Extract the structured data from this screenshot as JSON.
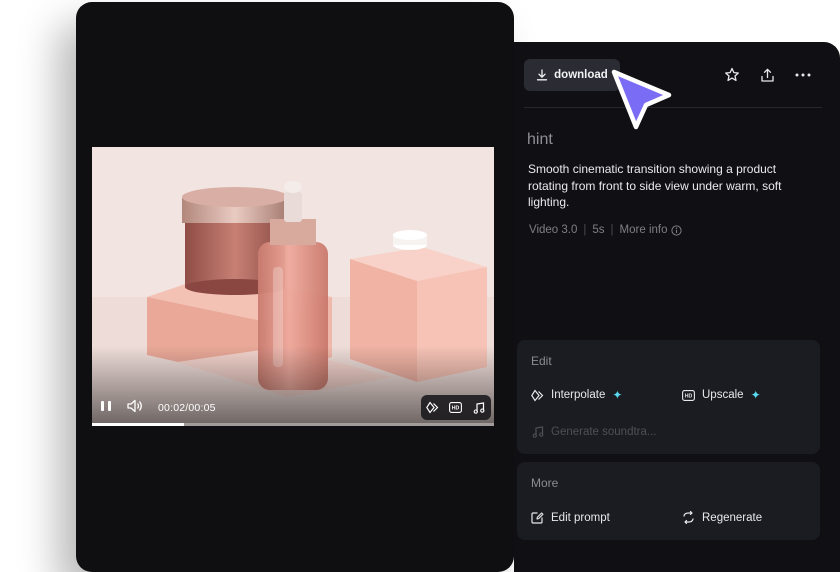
{
  "player": {
    "time": "00:02/00:05",
    "progress": 0.23,
    "icons": [
      "pause-icon",
      "volume-icon",
      "interpolate-icon",
      "hd-icon",
      "music-note-icon"
    ]
  },
  "header": {
    "download_label": "download",
    "icons": [
      "download-icon",
      "star-icon",
      "share-icon",
      "more-icon"
    ]
  },
  "details": {
    "hint": "hint",
    "prompt": "Smooth cinematic transition showing a product rotating from front to side view under warm, soft lighting.",
    "model": "Video 3.0",
    "duration": "5s",
    "more_info": "More info"
  },
  "edit": {
    "title": "Edit",
    "interpolate": "Interpolate",
    "upscale": "Upscale",
    "soundtrack": "Generate soundtra..."
  },
  "more": {
    "title": "More",
    "edit_prompt": "Edit prompt",
    "regenerate": "Regenerate"
  },
  "colors": {
    "accent_cursor": "#7b6cf6",
    "sparkle": "#59d9f0",
    "panel_bg": "#101014",
    "card_bg": "#1b1c21"
  }
}
